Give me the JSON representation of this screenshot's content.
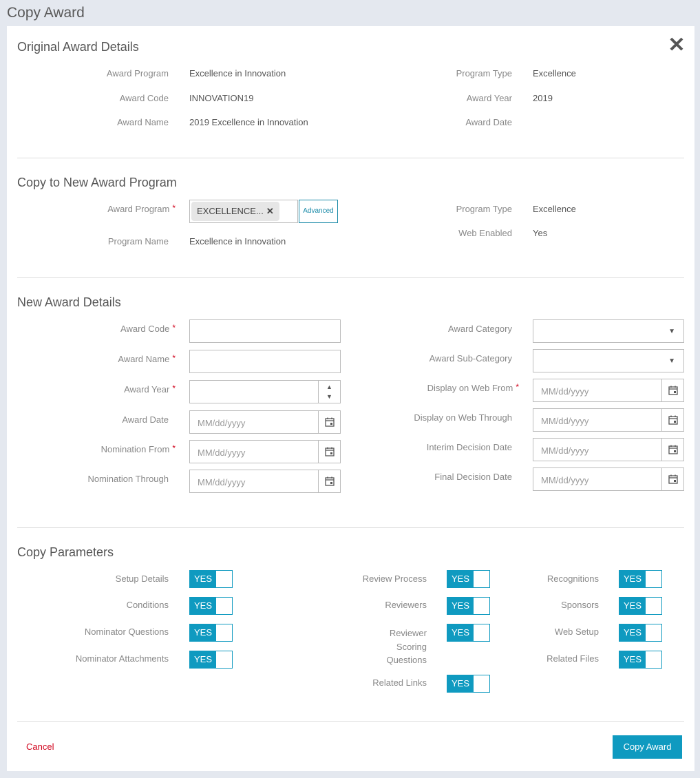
{
  "page_title": "Copy Award",
  "original": {
    "title": "Original Award Details",
    "award_program_label": "Award Program",
    "award_program_value": "Excellence in Innovation",
    "program_type_label": "Program Type",
    "program_type_value": "Excellence",
    "award_code_label": "Award Code",
    "award_code_value": "INNOVATION19",
    "award_year_label": "Award Year",
    "award_year_value": "2019",
    "award_name_label": "Award Name",
    "award_name_value": "2019 Excellence in Innovation",
    "award_date_label": "Award Date"
  },
  "copy_to": {
    "title": "Copy to New Award Program",
    "award_program_label": "Award Program",
    "award_program_tag": "EXCELLENCE...",
    "advanced_label": "Advanced",
    "program_type_label": "Program Type",
    "program_type_value": "Excellence",
    "program_name_label": "Program Name",
    "program_name_value": "Excellence in Innovation",
    "web_enabled_label": "Web Enabled",
    "web_enabled_value": "Yes"
  },
  "new_details": {
    "title": "New Award Details",
    "award_code_label": "Award Code",
    "award_name_label": "Award Name",
    "award_year_label": "Award Year",
    "award_date_label": "Award Date",
    "nomination_from_label": "Nomination From",
    "nomination_through_label": "Nomination Through",
    "award_category_label": "Award Category",
    "award_subcategory_label": "Award Sub-Category",
    "display_from_label": "Display on Web From",
    "display_through_label": "Display on Web Through",
    "interim_decision_label": "Interim Decision Date",
    "final_decision_label": "Final Decision Date",
    "date_placeholder": "MM/dd/yyyy",
    "required_mark": "*"
  },
  "params": {
    "title": "Copy Parameters",
    "toggle_label": "YES",
    "setup_details": "Setup Details",
    "conditions": "Conditions",
    "nominator_questions": "Nominator Questions",
    "nominator_attachments": "Nominator Attachments",
    "review_process": "Review Process",
    "reviewers": "Reviewers",
    "reviewer_scoring_1": "Reviewer",
    "reviewer_scoring_2": "Scoring",
    "reviewer_scoring_3": "Questions",
    "related_links": "Related Links",
    "recognitions": "Recognitions",
    "sponsors": "Sponsors",
    "web_setup": "Web Setup",
    "related_files": "Related Files"
  },
  "footer": {
    "cancel_label": "Cancel",
    "copy_label": "Copy Award"
  },
  "colors": {
    "accent": "#0f9ac0",
    "required": "#d0021b",
    "cancel": "#d0021b"
  }
}
